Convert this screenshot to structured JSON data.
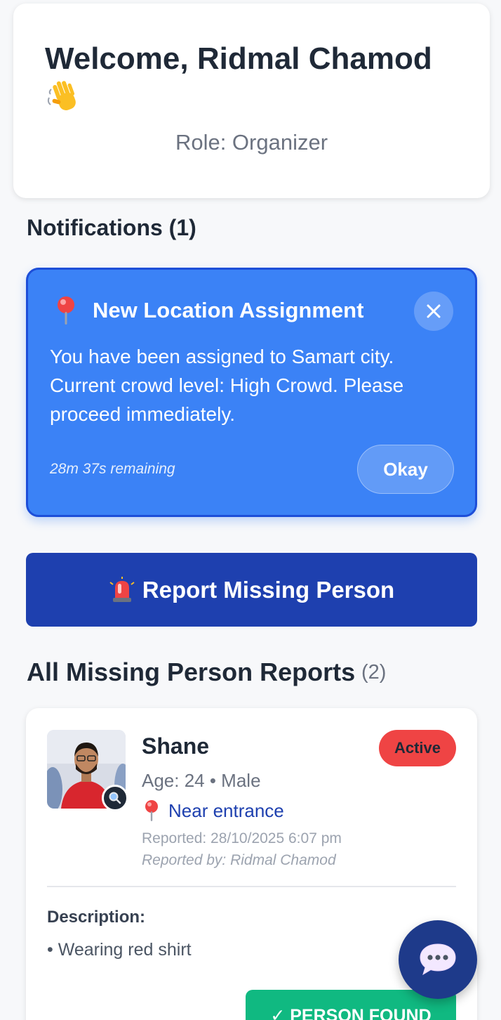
{
  "welcome": {
    "title": "Welcome, Ridmal Chamod",
    "emoji_icon": "waving-hand-icon",
    "role": "Role: Organizer"
  },
  "notifications": {
    "heading": "Notifications (1)",
    "items": [
      {
        "icon": "map-pin-icon",
        "title": "New Location Assignment",
        "body": "You have been assigned to Samart city. Current crowd level: High Crowd. Please proceed immediately.",
        "time_remaining": "28m 37s remaining",
        "action_label": "Okay",
        "close_icon": "close-icon"
      }
    ]
  },
  "report_button": {
    "icon": "siren-icon",
    "label": "Report Missing Person"
  },
  "reports": {
    "heading": "All Missing Person Reports",
    "count": "(2)",
    "items": [
      {
        "name": "Shane",
        "status": "Active",
        "meta": "Age: 24 • Male",
        "location": "Near entrance",
        "reported_at": "Reported: 28/10/2025 6:07 pm",
        "reported_by": "Reported by: Ridmal Chamod",
        "description_label": "Description:",
        "description_items": [
          "• Wearing red shirt"
        ],
        "found_label": "✓ PERSON FOUND"
      }
    ]
  },
  "chat_fab": {
    "icon": "chat-bubble-icon"
  },
  "colors": {
    "primary": "#1e40af",
    "notification_bg": "#3b82f6",
    "active_badge": "#ef4444",
    "found_button": "#10b981"
  }
}
